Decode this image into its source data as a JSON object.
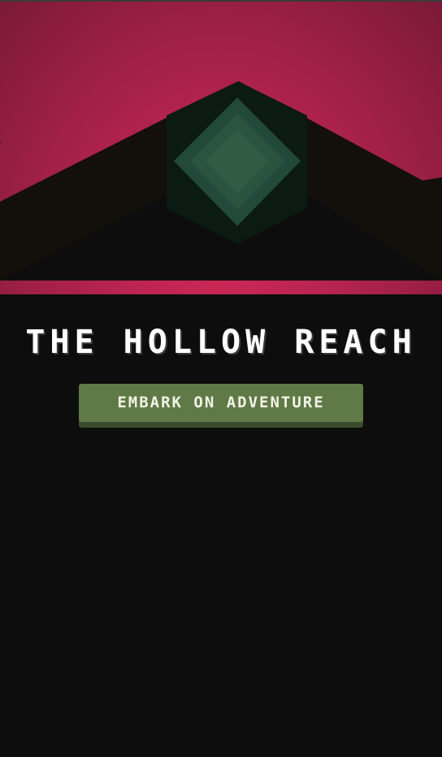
{
  "game": {
    "title": "THE HOLLOW REACH",
    "start_button_label": "EMBARK ON ADVENTURE"
  },
  "colors": {
    "sky": "#c0234f",
    "mountain_dark": "#130f0b",
    "ground": "#0d0d0d",
    "gem_green": "#2f5c42",
    "button": "#5f7a46",
    "button_shadow": "#3a4a2c",
    "title_text": "#ffffff"
  },
  "icons": {
    "crystal": "crystal-icon"
  }
}
